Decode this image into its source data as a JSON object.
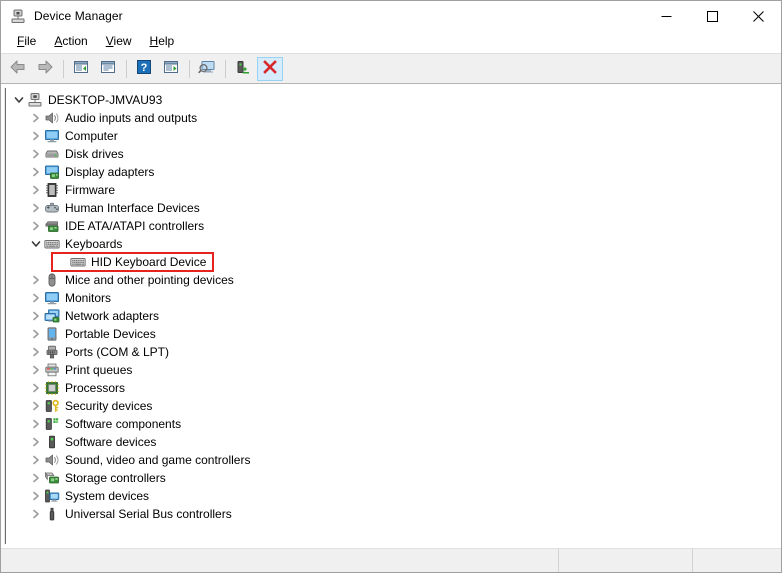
{
  "window": {
    "title": "Device Manager",
    "title_icon": "device-manager-icon",
    "controls": {
      "minimize": "minimize-icon",
      "maximize": "maximize-icon",
      "close": "close-icon"
    }
  },
  "menubar": {
    "items": [
      {
        "label": "File",
        "accel": "F"
      },
      {
        "label": "Action",
        "accel": "A"
      },
      {
        "label": "View",
        "accel": "V"
      },
      {
        "label": "Help",
        "accel": "H"
      }
    ]
  },
  "toolbar": {
    "buttons": [
      {
        "name": "back-button",
        "icon": "back-arrow-icon",
        "tooltip": "Back"
      },
      {
        "name": "forward-button",
        "icon": "forward-arrow-icon",
        "tooltip": "Forward"
      },
      {
        "name": "show-hide-console-tree-button",
        "icon": "console-tree-icon",
        "tooltip": "Show/Hide Console Tree"
      },
      {
        "name": "properties-button",
        "icon": "properties-icon",
        "tooltip": "Properties"
      },
      {
        "name": "help-button",
        "icon": "help-question-icon",
        "tooltip": "Help"
      },
      {
        "name": "update-driver-button",
        "icon": "update-driver-icon",
        "tooltip": "Update driver"
      },
      {
        "name": "scan-hardware-changes-button",
        "icon": "scan-monitor-icon",
        "tooltip": "Scan for hardware changes"
      },
      {
        "name": "enable-device-button",
        "icon": "enable-device-icon",
        "tooltip": "Enable device"
      },
      {
        "name": "uninstall-device-button",
        "icon": "red-x-icon",
        "tooltip": "Uninstall device"
      }
    ],
    "highlighted_button": "uninstall-device-button"
  },
  "tree": {
    "root": {
      "label": "DESKTOP-JMVAU93",
      "icon": "computer-root-icon",
      "expanded": true
    },
    "items": [
      {
        "label": "Audio inputs and outputs",
        "icon": "speaker-icon",
        "expanded": false,
        "depth": 1
      },
      {
        "label": "Computer",
        "icon": "monitor-icon",
        "expanded": false,
        "depth": 1
      },
      {
        "label": "Disk drives",
        "icon": "disk-drive-icon",
        "expanded": false,
        "depth": 1
      },
      {
        "label": "Display adapters",
        "icon": "display-adapter-icon",
        "expanded": false,
        "depth": 1
      },
      {
        "label": "Firmware",
        "icon": "firmware-chip-icon",
        "expanded": false,
        "depth": 1
      },
      {
        "label": "Human Interface Devices",
        "icon": "hid-gamepad-icon",
        "expanded": false,
        "depth": 1
      },
      {
        "label": "IDE ATA/ATAPI controllers",
        "icon": "ide-controller-icon",
        "expanded": false,
        "depth": 1
      },
      {
        "label": "Keyboards",
        "icon": "keyboard-icon",
        "expanded": true,
        "depth": 1
      },
      {
        "label": "HID Keyboard Device",
        "icon": "keyboard-icon",
        "expanded": null,
        "depth": 2,
        "highlighted": true
      },
      {
        "label": "Mice and other pointing devices",
        "icon": "mouse-icon",
        "expanded": false,
        "depth": 1
      },
      {
        "label": "Monitors",
        "icon": "monitor-icon",
        "expanded": false,
        "depth": 1
      },
      {
        "label": "Network adapters",
        "icon": "network-adapter-icon",
        "expanded": false,
        "depth": 1
      },
      {
        "label": "Portable Devices",
        "icon": "portable-device-icon",
        "expanded": false,
        "depth": 1
      },
      {
        "label": "Ports (COM & LPT)",
        "icon": "port-icon",
        "expanded": false,
        "depth": 1
      },
      {
        "label": "Print queues",
        "icon": "printer-icon",
        "expanded": false,
        "depth": 1
      },
      {
        "label": "Processors",
        "icon": "processor-icon",
        "expanded": false,
        "depth": 1
      },
      {
        "label": "Security devices",
        "icon": "security-key-icon",
        "expanded": false,
        "depth": 1
      },
      {
        "label": "Software components",
        "icon": "software-component-icon",
        "expanded": false,
        "depth": 1
      },
      {
        "label": "Software devices",
        "icon": "software-device-icon",
        "expanded": false,
        "depth": 1
      },
      {
        "label": "Sound, video and game controllers",
        "icon": "speaker-icon",
        "expanded": false,
        "depth": 1
      },
      {
        "label": "Storage controllers",
        "icon": "storage-controller-icon",
        "expanded": false,
        "depth": 1
      },
      {
        "label": "System devices",
        "icon": "system-device-icon",
        "expanded": false,
        "depth": 1
      },
      {
        "label": "Universal Serial Bus controllers",
        "icon": "usb-icon",
        "expanded": false,
        "depth": 1
      }
    ]
  },
  "statusbar": {
    "pane1": "",
    "pane2": "",
    "pane3": ""
  },
  "colors": {
    "annotation": "#e8231e",
    "toolbar_bg": "#f0f0f0",
    "hover_bg": "#d6ebfb",
    "window_bg": "#ffffff"
  }
}
